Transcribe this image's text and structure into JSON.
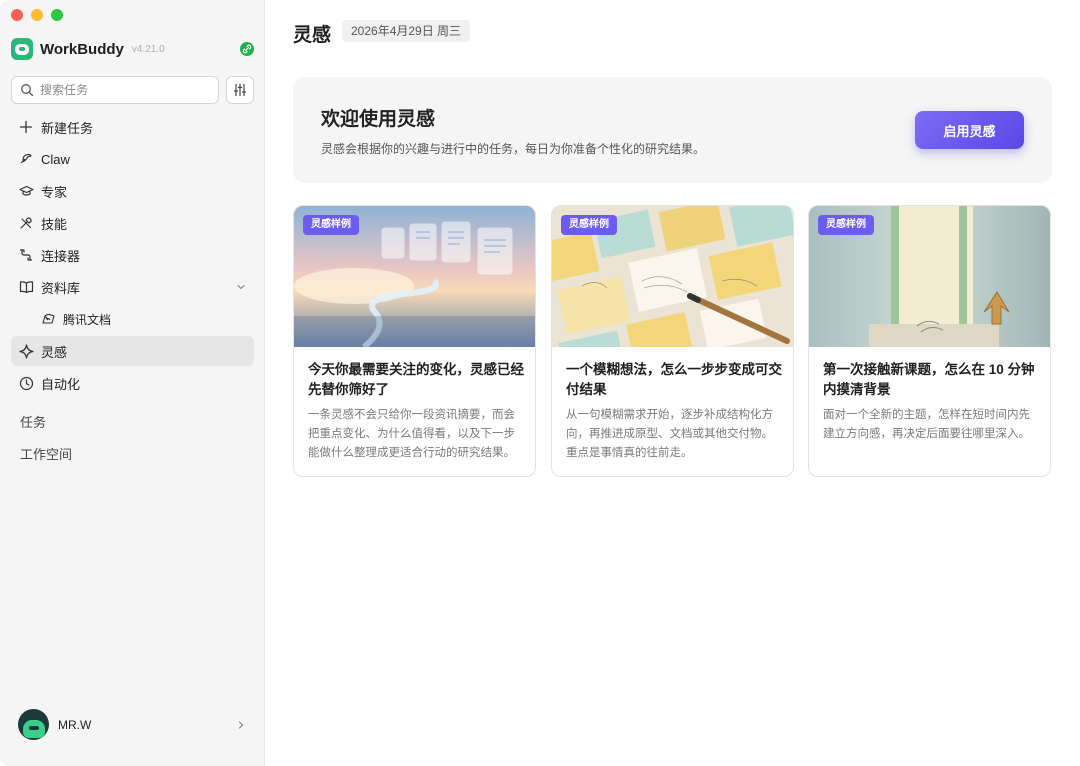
{
  "app": {
    "name": "WorkBuddy",
    "version": "v4.21.0"
  },
  "search": {
    "placeholder": "搜索任务"
  },
  "sidebar": {
    "items": [
      {
        "label": "新建任务",
        "icon": "plus-icon"
      },
      {
        "label": "Claw",
        "icon": "claw-icon"
      },
      {
        "label": "专家",
        "icon": "graduation-cap-icon"
      },
      {
        "label": "技能",
        "icon": "tools-icon"
      },
      {
        "label": "连接器",
        "icon": "connector-icon"
      },
      {
        "label": "资料库",
        "icon": "book-icon"
      },
      {
        "label": "腾讯文档",
        "icon": "tencent-docs-icon"
      },
      {
        "label": "灵感",
        "icon": "sparkle-icon"
      },
      {
        "label": "自动化",
        "icon": "clock-icon"
      }
    ],
    "sections": {
      "tasks": "任务",
      "workspace": "工作空间"
    }
  },
  "user": {
    "name": "MR.W"
  },
  "main": {
    "title": "灵感",
    "date": "2026年4月29日 周三",
    "welcome": {
      "title": "欢迎使用灵感",
      "description": "灵感会根据你的兴趣与进行中的任务，每日为你准备个性化的研究结果。",
      "button": "启用灵感"
    },
    "cards": [
      {
        "tag": "灵感样例",
        "title": "今天你最需要关注的变化，灵感已经先替你筛好了",
        "description": "一条灵感不会只给你一段资讯摘要，而会把重点变化、为什么值得看，以及下一步能做什么整理成更适合行动的研究结果。"
      },
      {
        "tag": "灵感样例",
        "title": "一个模糊想法，怎么一步步变成可交付结果",
        "description": "从一句模糊需求开始，逐步补成结构化方向，再推进成原型、文档或其他交付物。重点是事情真的往前走。"
      },
      {
        "tag": "灵感样例",
        "title": "第一次接触新课题，怎么在 10 分钟内摸清背景",
        "description": "面对一个全新的主题，怎样在短时间内先建立方向感，再决定后面要往哪里深入。"
      }
    ]
  },
  "colors": {
    "accent": "#6d5cf0",
    "active_bg": "#e6e6e6",
    "sidebar_bg": "#f5f5f5",
    "link_badge": "#22b24c"
  }
}
